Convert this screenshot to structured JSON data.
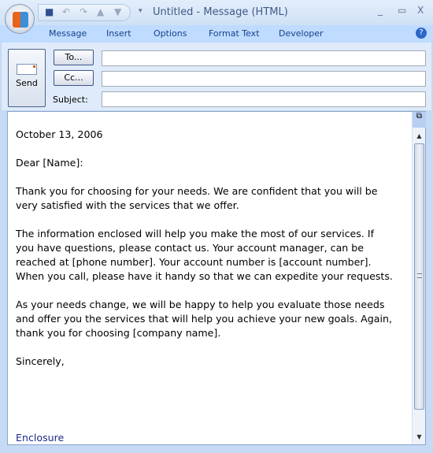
{
  "window": {
    "title": "Untitled - Message (HTML)",
    "minimize": "_",
    "maximize": "▭",
    "close": "X"
  },
  "ribbon": {
    "tabs": [
      "Message",
      "Insert",
      "Options",
      "Format Text",
      "Developer"
    ],
    "help": "?"
  },
  "header": {
    "send_label": "Send",
    "to_label": "To...",
    "cc_label": "Cc...",
    "subject_label": "Subject:",
    "to_value": "",
    "cc_value": "",
    "subject_value": ""
  },
  "body": {
    "paragraphs": [
      "October 13, 2006",
      "Dear [Name]:",
      "Thank you for choosing for your needs. We are confident that you will be very satisfied with the services that we offer.",
      "The information enclosed will help you make the most of our services. If you have questions, please contact us. Your account manager, can be reached at [phone number]. Your account number is [account number]. When you call, please have it handy so that we can expedite your requests.",
      "As your needs change, we will be happy to help you evaluate those needs and offer you the services that will help you achieve your new goals. Again, thank you for choosing [company name].",
      "Sincerely,"
    ],
    "enclosure": "Enclosure"
  }
}
